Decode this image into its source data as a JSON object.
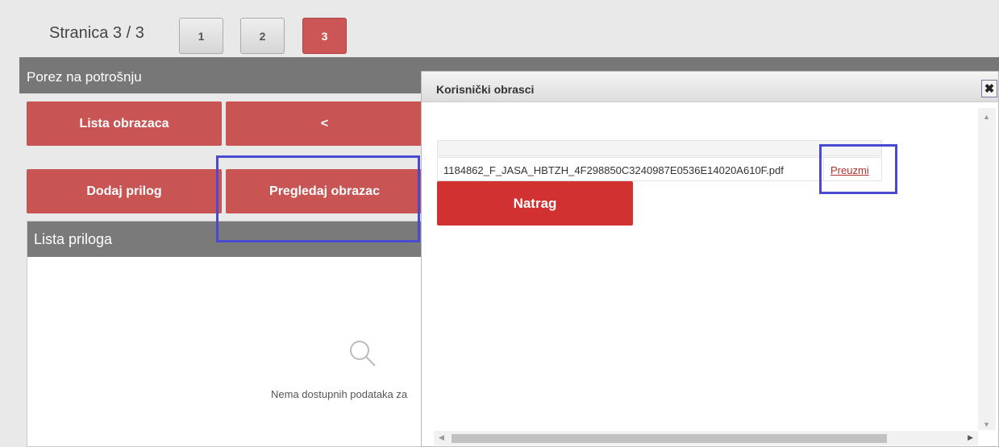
{
  "pager": {
    "label": "Stranica 3 / 3",
    "pages": [
      "1",
      "2",
      "3"
    ],
    "active_page": "3"
  },
  "panel": {
    "title": "Porez na potrošnju",
    "buttons": {
      "list_forms": "Lista obrazaca",
      "back_arrow": "<",
      "add_attachment": "Dodaj prilog",
      "preview_form": "Pregledaj obrazac"
    },
    "attachments": {
      "title": "Lista priloga",
      "empty_text": "Nema dostupnih podataka za"
    }
  },
  "dialog": {
    "title": "Korisnički obrasci",
    "close_label": "✖",
    "file": {
      "name": "1184862_F_JASA_HBTZH_4F298850C3240987E0536E14020A610F.pdf",
      "download_label": "Preuzmi"
    },
    "back_button": "Natrag"
  },
  "colors": {
    "primary_red": "#c95454",
    "dialog_red": "#d23131",
    "highlight": "#4a4ad0",
    "header_gray": "#777777"
  }
}
